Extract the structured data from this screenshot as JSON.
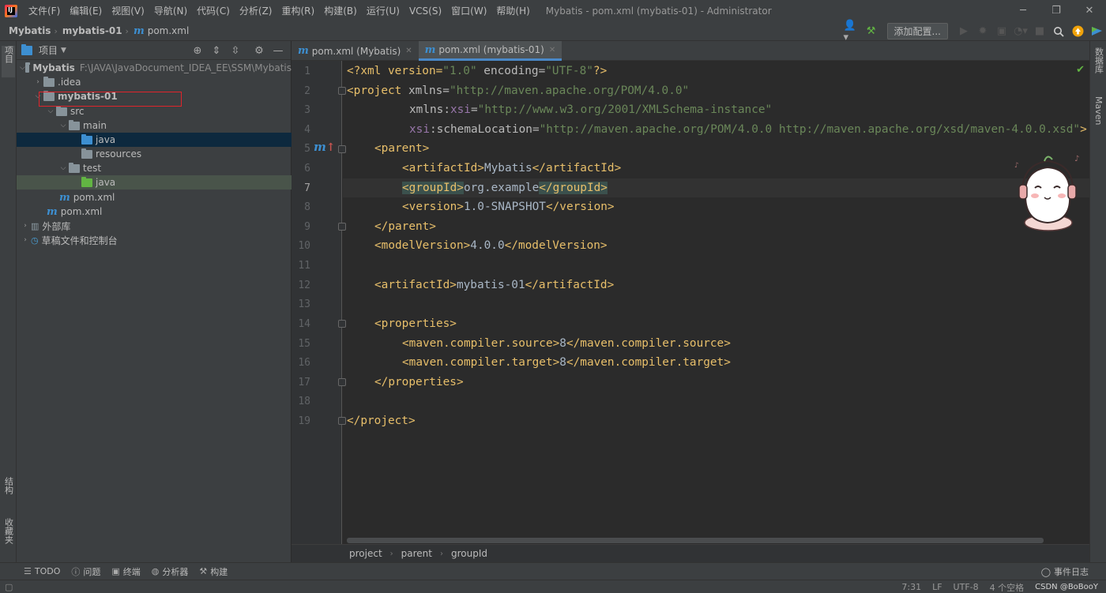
{
  "menu": [
    "文件(F)",
    "编辑(E)",
    "视图(V)",
    "导航(N)",
    "代码(C)",
    "分析(Z)",
    "重构(R)",
    "构建(B)",
    "运行(U)",
    "VCS(S)",
    "窗口(W)",
    "帮助(H)"
  ],
  "window_title": "Mybatis - pom.xml (mybatis-01) - Administrator",
  "breadcrumb": {
    "root": "Mybatis",
    "module": "mybatis-01",
    "file": "pom.xml"
  },
  "toolbar": {
    "add_config": "添加配置..."
  },
  "left_strip": {
    "project": "项目",
    "structure": "结构",
    "favorites": "收藏夹"
  },
  "right_strip": {
    "database": "数据库",
    "maven": "Maven"
  },
  "project_panel": {
    "title": "项目",
    "tree": [
      {
        "label": "Mybatis",
        "path": "F:\\JAVA\\JavaDocument_IDEA_EE\\SSM\\Mybatis"
      },
      {
        "label": ".idea"
      },
      {
        "label": "mybatis-01"
      },
      {
        "label": "src"
      },
      {
        "label": "main"
      },
      {
        "label": "java"
      },
      {
        "label": "resources"
      },
      {
        "label": "test"
      },
      {
        "label": "java"
      },
      {
        "label": "pom.xml"
      },
      {
        "label": "pom.xml"
      },
      {
        "label": "外部库"
      },
      {
        "label": "草稿文件和控制台"
      }
    ]
  },
  "editor": {
    "tabs": [
      "pom.xml (Mybatis)",
      "pom.xml (mybatis-01)"
    ],
    "active_tab": 1,
    "current_line": 7,
    "line_numbers": [
      "1",
      "2",
      "3",
      "4",
      "5",
      "6",
      "7",
      "8",
      "9",
      "10",
      "11",
      "12",
      "13",
      "14",
      "15",
      "16",
      "17",
      "18",
      "19"
    ],
    "code": {
      "l1": {
        "a": "<?xml version=",
        "b": "\"1.0\"",
        "c": " encoding=",
        "d": "\"UTF-8\"",
        "e": "?>"
      },
      "l2": {
        "a": "<project ",
        "b": "xmlns=",
        "c": "\"http://maven.apache.org/POM/4.0.0\""
      },
      "l3": {
        "a": "xmlns:",
        "b": "xsi",
        "c": "=",
        "d": "\"http://www.w3.org/2001/XMLSchema-instance\""
      },
      "l4": {
        "a": "xsi",
        "b": ":schemaLocation=",
        "c": "\"http://maven.apache.org/POM/4.0.0 http://maven.apache.org/xsd/maven-4.0.0.xsd\"",
        "d": ">"
      },
      "l5": "<parent>",
      "l6": {
        "open": "<artifactId>",
        "text": "Mybatis",
        "close": "</artifactId>"
      },
      "l7": {
        "open": "<groupId>",
        "text": "org.example",
        "close": "</groupId>"
      },
      "l8": {
        "open": "<version>",
        "text": "1.0-SNAPSHOT",
        "close": "</version>"
      },
      "l9": "</parent>",
      "l10": {
        "open": "<modelVersion>",
        "text": "4.0.0",
        "close": "</modelVersion>"
      },
      "l12": {
        "open": "<artifactId>",
        "text": "mybatis-01",
        "close": "</artifactId>"
      },
      "l14": "<properties>",
      "l15": {
        "open": "<maven.compiler.source>",
        "text": "8",
        "close": "</maven.compiler.source>"
      },
      "l16": {
        "open": "<maven.compiler.target>",
        "text": "8",
        "close": "</maven.compiler.target>"
      },
      "l17": "</properties>",
      "l19": "</project>"
    },
    "breadcrumbs": [
      "project",
      "parent",
      "groupId"
    ]
  },
  "bottom_tools": [
    "TODO",
    "问题",
    "终端",
    "分析器",
    "构建"
  ],
  "event_log": "事件日志",
  "status": {
    "position": "7:31",
    "line_sep": "LF",
    "encoding": "UTF-8",
    "indent": "4 个空格",
    "watermark": "CSDN @BoBooY"
  },
  "colors": {
    "tag": "#e8bf6a",
    "string": "#6a8759",
    "selection": "#0d293e",
    "accent": "#4a88c7"
  }
}
